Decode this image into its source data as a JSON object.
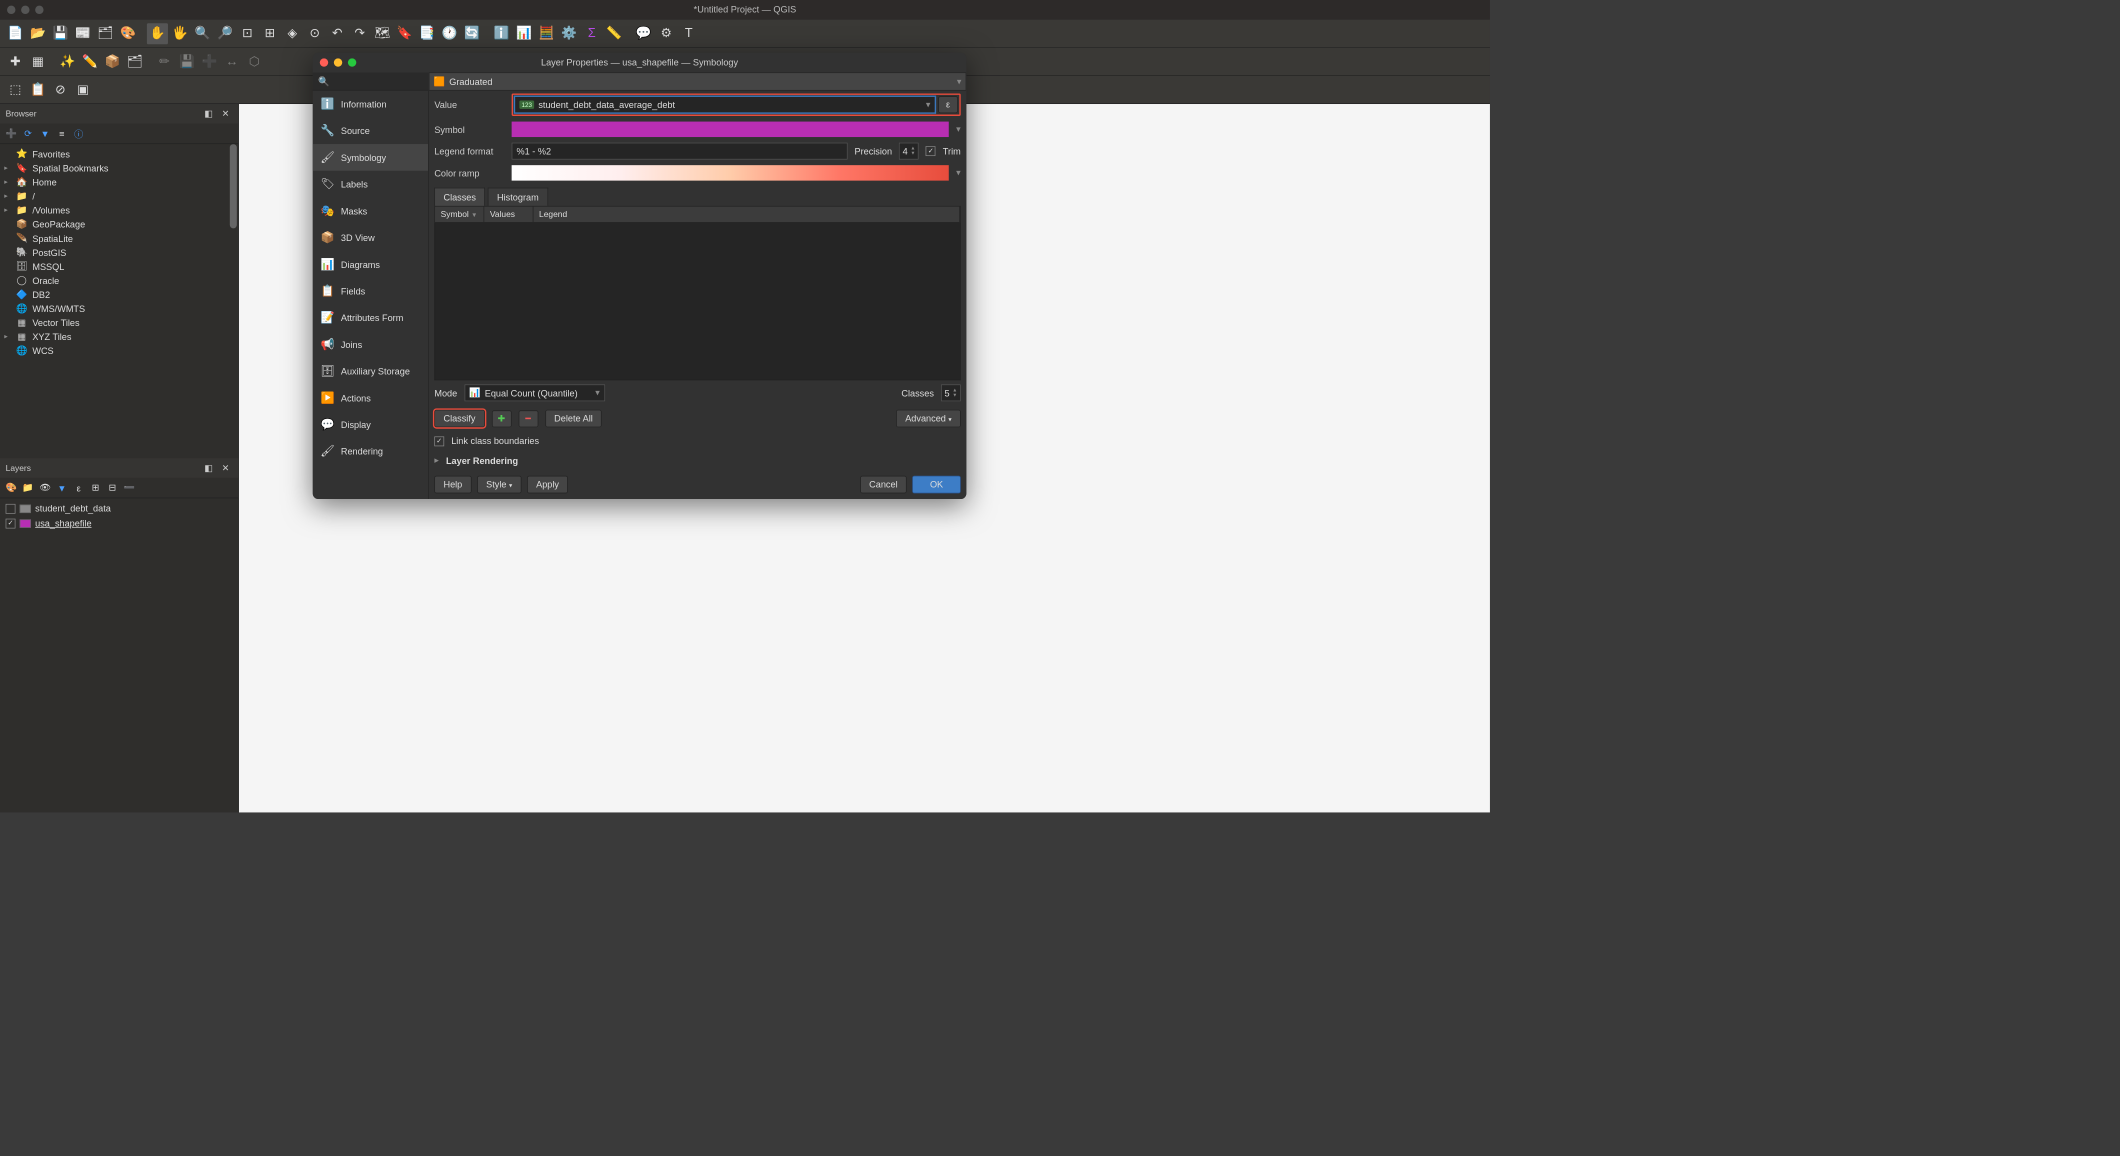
{
  "window_title": "*Untitled Project — QGIS",
  "browser": {
    "title": "Browser",
    "items": [
      {
        "icon": "⭐",
        "label": "Favorites",
        "color": "#f5c84c"
      },
      {
        "expand": "▸",
        "icon": "🔖",
        "label": "Spatial Bookmarks"
      },
      {
        "expand": "▸",
        "icon": "🏠",
        "label": "Home"
      },
      {
        "expand": "▸",
        "icon": "📁",
        "label": "/"
      },
      {
        "expand": "▸",
        "icon": "📁",
        "label": "/Volumes"
      },
      {
        "expand": "",
        "icon": "📦",
        "label": "GeoPackage"
      },
      {
        "expand": "",
        "icon": "🪶",
        "label": "SpatiaLite"
      },
      {
        "expand": "",
        "icon": "🐘",
        "label": "PostGIS"
      },
      {
        "expand": "",
        "icon": "🗄",
        "label": "MSSQL"
      },
      {
        "expand": "",
        "icon": "◯",
        "label": "Oracle"
      },
      {
        "expand": "",
        "icon": "🔷",
        "label": "DB2"
      },
      {
        "expand": "",
        "icon": "🌐",
        "label": "WMS/WMTS"
      },
      {
        "expand": "",
        "icon": "▦",
        "label": "Vector Tiles"
      },
      {
        "expand": "▸",
        "icon": "▦",
        "label": "XYZ Tiles"
      },
      {
        "expand": "",
        "icon": "🌐",
        "label": "WCS"
      }
    ]
  },
  "layers": {
    "title": "Layers",
    "items": [
      {
        "checked": false,
        "swatch": "#888",
        "label": "student_debt_data",
        "underline": false
      },
      {
        "checked": true,
        "swatch": "#b82eb3",
        "label": "usa_shapefile",
        "underline": true
      }
    ]
  },
  "dialog": {
    "title": "Layer Properties — usa_shapefile — Symbology",
    "sidebar": [
      {
        "icon": "ℹ️",
        "label": "Information"
      },
      {
        "icon": "🔧",
        "label": "Source"
      },
      {
        "icon": "🖌",
        "label": "Symbology",
        "selected": true
      },
      {
        "icon": "🏷",
        "label": "Labels"
      },
      {
        "icon": "🎭",
        "label": "Masks"
      },
      {
        "icon": "📦",
        "label": "3D View"
      },
      {
        "icon": "📊",
        "label": "Diagrams"
      },
      {
        "icon": "📋",
        "label": "Fields"
      },
      {
        "icon": "📝",
        "label": "Attributes Form"
      },
      {
        "icon": "📢",
        "label": "Joins"
      },
      {
        "icon": "🗄",
        "label": "Auxiliary Storage"
      },
      {
        "icon": "▶️",
        "label": "Actions"
      },
      {
        "icon": "💬",
        "label": "Display"
      },
      {
        "icon": "🖌",
        "label": "Rendering"
      }
    ],
    "renderer_type": "Graduated",
    "value_label": "Value",
    "value_field": "student_debt_data_average_debt",
    "value_type_badge": "123",
    "symbol_label": "Symbol",
    "legend_format_label": "Legend format",
    "legend_format": "%1 - %2",
    "precision_label": "Precision",
    "precision_value": "4",
    "trim_label": "Trim",
    "trim_checked": true,
    "color_ramp_label": "Color ramp",
    "tabs": {
      "classes": "Classes",
      "histogram": "Histogram"
    },
    "columns": {
      "symbol": "Symbol",
      "values": "Values",
      "legend": "Legend"
    },
    "mode_label": "Mode",
    "mode_value": "Equal Count (Quantile)",
    "classes_label": "Classes",
    "classes_value": "5",
    "classify_btn": "Classify",
    "delete_all_btn": "Delete All",
    "advanced_btn": "Advanced",
    "link_boundaries_label": "Link class boundaries",
    "link_boundaries_checked": true,
    "layer_rendering_label": "Layer Rendering",
    "buttons": {
      "help": "Help",
      "style": "Style",
      "apply": "Apply",
      "cancel": "Cancel",
      "ok": "OK"
    }
  }
}
